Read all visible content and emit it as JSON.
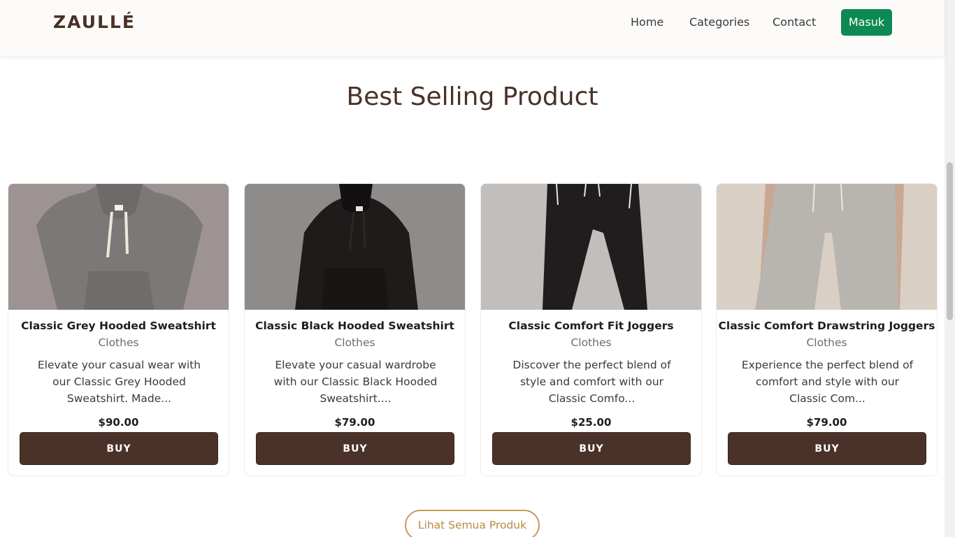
{
  "brand": "ZAULLÉ",
  "nav": {
    "home": "Home",
    "categories": "Categories",
    "contact": "Contact",
    "login": "Masuk"
  },
  "section_title": "Best Selling Product",
  "products": [
    {
      "title": "Classic Grey Hooded Sweatshirt",
      "category": "Clothes",
      "description": "Elevate your casual wear with our Classic Grey Hooded Sweatshirt. Made...",
      "price": "$90.00",
      "buy_label": "BUY",
      "image_icon": "grey-hoodie-photo"
    },
    {
      "title": "Classic Black Hooded Sweatshirt",
      "category": "Clothes",
      "description": "Elevate your casual wardrobe with our Classic Black Hooded Sweatshirt....",
      "price": "$79.00",
      "buy_label": "BUY",
      "image_icon": "black-hoodie-photo"
    },
    {
      "title": "Classic Comfort Fit Joggers",
      "category": "Clothes",
      "description": "Discover the perfect blend of style and comfort with our Classic Comfo...",
      "price": "$25.00",
      "buy_label": "BUY",
      "image_icon": "black-joggers-photo"
    },
    {
      "title": "Classic Comfort Drawstring Joggers",
      "category": "Clothes",
      "description": "Experience the perfect blend of comfort and style with our Classic Com...",
      "price": "$79.00",
      "buy_label": "BUY",
      "image_icon": "beige-joggers-photo"
    }
  ],
  "view_all_label": "Lihat Semua Produk",
  "colors": {
    "brand_brown": "#4a3128",
    "buy_button": "#4b3229",
    "login_button": "#0d8a54",
    "view_all_border": "#c79a57"
  }
}
